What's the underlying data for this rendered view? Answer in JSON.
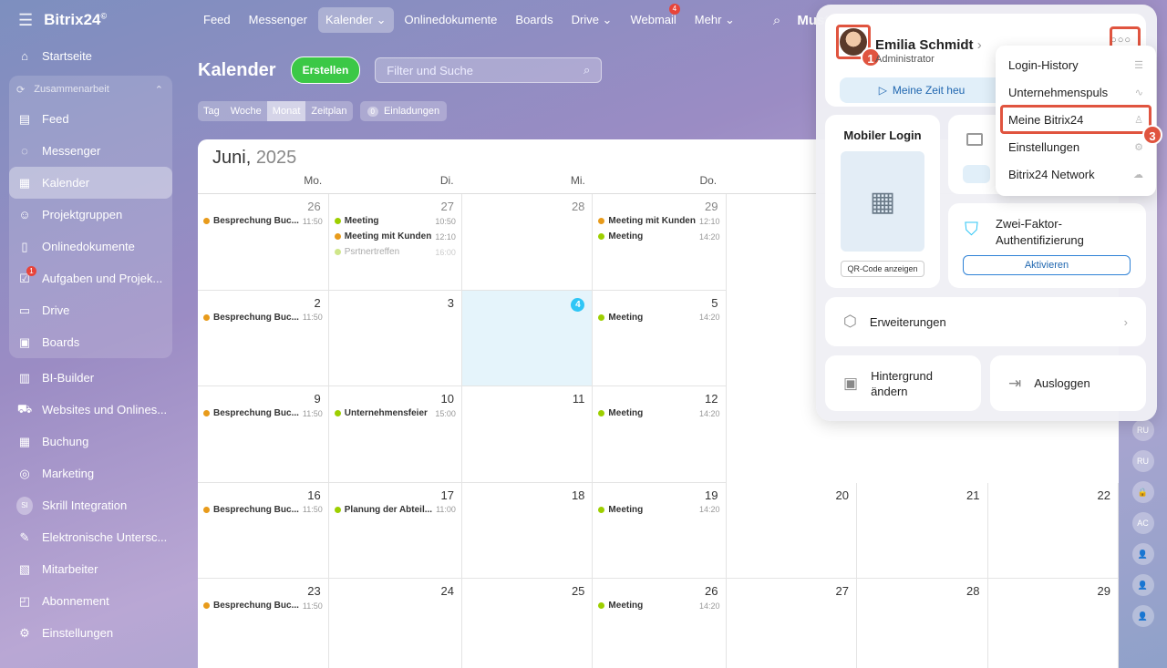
{
  "brand": {
    "name": "Bitrix24",
    "mark": "©"
  },
  "sidebar": {
    "items_top": [
      {
        "label": "Startseite",
        "icon": "home-icon"
      }
    ],
    "group_label": "Zusammenarbeit",
    "group_items": [
      {
        "label": "Feed",
        "icon": "feed-icon"
      },
      {
        "label": "Messenger",
        "icon": "messenger-icon"
      },
      {
        "label": "Kalender",
        "icon": "calendar-icon",
        "active": true
      },
      {
        "label": "Projektgruppen",
        "icon": "groups-icon"
      },
      {
        "label": "Onlinedokumente",
        "icon": "document-icon"
      },
      {
        "label": "Aufgaben und Projek...",
        "icon": "tasks-icon",
        "badge": "1"
      },
      {
        "label": "Drive",
        "icon": "drive-icon"
      },
      {
        "label": "Boards",
        "icon": "boards-icon"
      }
    ],
    "items_bottom": [
      {
        "label": "BI-Builder",
        "icon": "chart-icon"
      },
      {
        "label": "Websites und Onlines...",
        "icon": "cart-icon"
      },
      {
        "label": "Buchung",
        "icon": "booking-icon"
      },
      {
        "label": "Marketing",
        "icon": "target-icon"
      },
      {
        "label": "Skrill Integration",
        "icon": "si-avatar",
        "avatar": "SI"
      },
      {
        "label": "Elektronische Untersc...",
        "icon": "signature-icon"
      },
      {
        "label": "Mitarbeiter",
        "icon": "employees-icon"
      },
      {
        "label": "Abonnement",
        "icon": "subscription-icon"
      },
      {
        "label": "Einstellungen",
        "icon": "gear-icon"
      }
    ]
  },
  "topnav": {
    "items": [
      "Feed",
      "Messenger",
      "Kalender ⌄",
      "Onlinedokumente",
      "Boards",
      "Drive ⌄",
      "Webmail",
      "Mehr ⌄"
    ],
    "webmail_badge": "4",
    "company": "Must"
  },
  "calendar": {
    "title": "Kalender",
    "create": "Erstellen",
    "filter_placeholder": "Filter und Suche",
    "views": [
      "Tag",
      "Woche",
      "Monat",
      "Zeitplan"
    ],
    "invitations_count": "0",
    "invitations": "Einladungen",
    "month": "Juni,",
    "year": "2025",
    "weekdays": [
      "Mo.",
      "Di.",
      "Mi.",
      "Do.",
      "",
      "",
      ""
    ],
    "weeks": [
      [
        {
          "n": "26",
          "faded": true,
          "ev": [
            {
              "t": "Besprechung Buc...",
              "tm": "11:50",
              "c": "#e89b1b"
            }
          ]
        },
        {
          "n": "27",
          "faded": true,
          "ev": [
            {
              "t": "Meeting",
              "tm": "10:50",
              "c": "#9dcf00"
            },
            {
              "t": "Meeting mit Kunden",
              "tm": "12:10",
              "c": "#e89b1b"
            },
            {
              "t": "Psrtnertreffen",
              "tm": "16:00",
              "c": "#cfe68a",
              "dim": true
            }
          ]
        },
        {
          "n": "28",
          "faded": true,
          "ev": []
        },
        {
          "n": "29",
          "faded": true,
          "ev": [
            {
              "t": "Meeting mit Kunden",
              "tm": "12:10",
              "c": "#e89b1b"
            },
            {
              "t": "Meeting",
              "tm": "14:20",
              "c": "#9dcf00"
            }
          ]
        },
        {
          "n": "",
          "ev": []
        },
        {
          "n": "",
          "ev": []
        },
        {
          "n": "",
          "ev": []
        }
      ],
      [
        {
          "n": "2",
          "ev": [
            {
              "t": "Besprechung Buc...",
              "tm": "11:50",
              "c": "#e89b1b"
            }
          ]
        },
        {
          "n": "3",
          "ev": []
        },
        {
          "n": "4",
          "today": true,
          "ev": []
        },
        {
          "n": "5",
          "ev": [
            {
              "t": "Meeting",
              "tm": "14:20",
              "c": "#9dcf00"
            }
          ]
        },
        {
          "n": "",
          "ev": []
        },
        {
          "n": "",
          "ev": []
        },
        {
          "n": "",
          "ev": []
        }
      ],
      [
        {
          "n": "9",
          "ev": [
            {
              "t": "Besprechung Buc...",
              "tm": "11:50",
              "c": "#e89b1b"
            }
          ]
        },
        {
          "n": "10",
          "ev": [
            {
              "t": "Unternehmensfeier",
              "tm": "15:00",
              "c": "#9dcf00"
            }
          ]
        },
        {
          "n": "11",
          "ev": []
        },
        {
          "n": "12",
          "ev": [
            {
              "t": "Meeting",
              "tm": "14:20",
              "c": "#9dcf00"
            }
          ]
        },
        {
          "n": "",
          "ev": []
        },
        {
          "n": "",
          "ev": []
        },
        {
          "n": "",
          "ev": []
        }
      ],
      [
        {
          "n": "16",
          "ev": [
            {
              "t": "Besprechung Buc...",
              "tm": "11:50",
              "c": "#e89b1b"
            }
          ]
        },
        {
          "n": "17",
          "ev": [
            {
              "t": "Planung der Abteil...",
              "tm": "11:00",
              "c": "#9dcf00"
            }
          ]
        },
        {
          "n": "18",
          "ev": []
        },
        {
          "n": "19",
          "ev": [
            {
              "t": "Meeting",
              "tm": "14:20",
              "c": "#9dcf00"
            }
          ]
        },
        {
          "n": "20",
          "ev": []
        },
        {
          "n": "21",
          "ev": []
        },
        {
          "n": "22",
          "ev": []
        }
      ],
      [
        {
          "n": "23",
          "ev": [
            {
              "t": "Besprechung Buc...",
              "tm": "11:50",
              "c": "#e89b1b"
            }
          ]
        },
        {
          "n": "24",
          "ev": []
        },
        {
          "n": "25",
          "ev": []
        },
        {
          "n": "26",
          "ev": [
            {
              "t": "Meeting",
              "tm": "14:20",
              "c": "#9dcf00"
            }
          ]
        },
        {
          "n": "27",
          "ev": []
        },
        {
          "n": "28",
          "ev": []
        },
        {
          "n": "29",
          "ev": []
        }
      ]
    ]
  },
  "rightbar": [
    "RU",
    "RU",
    "🔒",
    "AC",
    "👤",
    "👤",
    "👤"
  ],
  "profile": {
    "name": "Emilia Schmidt",
    "role": "Administrator",
    "time_btn": "Meine Zeit heu",
    "mobile_title": "Mobiler Login",
    "qr_btn": "QR-Code anzeigen",
    "twofa_title": "Zwei-Faktor-Authentifizierung",
    "activate": "Aktivieren",
    "extensions": "Erweiterungen",
    "background": "Hintergrund ändern",
    "logout": "Ausloggen",
    "steps": [
      "1",
      "2",
      "3"
    ]
  },
  "menu": {
    "items": [
      {
        "label": "Login-History",
        "icon": "list-icon"
      },
      {
        "label": "Unternehmenspuls",
        "icon": "pulse-icon"
      },
      {
        "label": "Meine Bitrix24",
        "icon": "user-icon"
      },
      {
        "label": "Einstellungen",
        "icon": "gear-icon"
      },
      {
        "label": "Bitrix24 Network",
        "icon": "cloud-icon"
      }
    ]
  }
}
